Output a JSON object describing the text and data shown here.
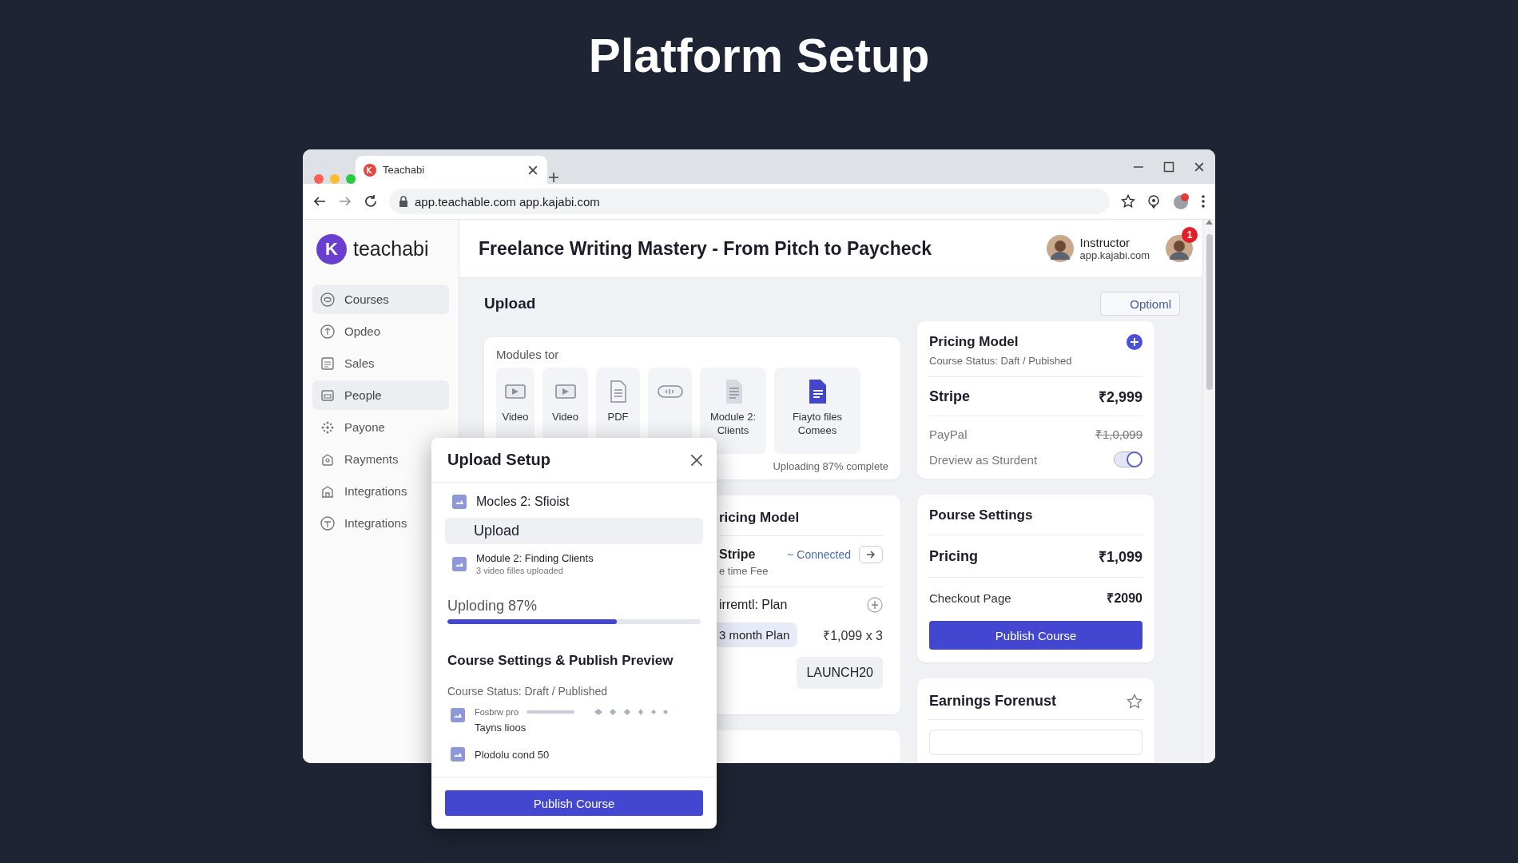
{
  "page_title": "Platform Setup",
  "browser": {
    "tab_title": "Teachabi",
    "url": "app.teachable.com app.kajabi.com"
  },
  "sidebar": {
    "brand_letter": "K",
    "brand": "teachabi",
    "items": [
      {
        "label": "Courses",
        "selected": true
      },
      {
        "label": "Opdeo",
        "selected": false
      },
      {
        "label": "Sales",
        "selected": false
      },
      {
        "label": "People",
        "selected": true
      },
      {
        "label": "Payone",
        "selected": false
      },
      {
        "label": "Rayments",
        "selected": false
      },
      {
        "label": "Integrations",
        "selected": false
      },
      {
        "label": "Integrations",
        "selected": false
      }
    ]
  },
  "header": {
    "title": "Freelance Writing Mastery - From Pitch to Paycheck",
    "user_role": "Instructor",
    "user_domain": "app.kajabi.com",
    "notification_badge": "1"
  },
  "upload": {
    "heading": "Upload",
    "option_button": "Optioml"
  },
  "modules_card": {
    "title": "Modules tor",
    "tiles": [
      {
        "kind": "video",
        "label": "Video"
      },
      {
        "kind": "video",
        "label": "Video"
      },
      {
        "kind": "pdf",
        "label": "PDF"
      },
      {
        "kind": "link"
      },
      {
        "kind": "doc",
        "label": "Module 2: Clients"
      },
      {
        "kind": "file",
        "label": "Fiayto files Comees"
      }
    ],
    "status": "Uploading 87% complete"
  },
  "pricing_middle": {
    "title": "ricing Model",
    "provider": "Stripe",
    "connection": "~ Connected",
    "fee": "e time Fee",
    "plan_heading": "irremtl: Plan",
    "plan": "3 month Plan",
    "plan_price": "₹1,099 x 3",
    "coupon": "LAUNCH20"
  },
  "pricing_model": {
    "title": "Pricing Model",
    "status": "Course Status: Daft / Pubished",
    "rows": [
      {
        "kind": "primary",
        "label": "Stripe",
        "value": "₹2,999"
      },
      {
        "kind": "struck",
        "label": "PayPal",
        "value": "₹1,0,099"
      }
    ],
    "preview_toggle": {
      "label": "Dreview as Sturdent",
      "on": true
    }
  },
  "course_settings": {
    "title": "Pourse Settings",
    "rows": [
      {
        "kind": "primary",
        "label": "Pricing",
        "value": "₹1,099"
      },
      {
        "kind": "plain",
        "label": "Checkout Page",
        "value": "₹2090"
      }
    ],
    "button": "Publish Course"
  },
  "earnings": {
    "title": "Earnings Forenust"
  },
  "modal": {
    "title": "Upload Setup",
    "items": [
      {
        "kind": "module",
        "title": "Mocles 2: Sfioist"
      },
      {
        "kind": "upload",
        "title": "Upload"
      },
      {
        "kind": "module",
        "title": "Module 2: Finding Clients",
        "subtitle": "3 video filles uploaded"
      }
    ],
    "progress": {
      "label": "Uploding 87%",
      "level": 0.67
    },
    "section_title": "Course Settings & Publish Preview",
    "status": "Course Status: Draft / Published",
    "preview_items": [
      {
        "kind": "scale",
        "label": "Fosbrw pro",
        "note": "Tayns lioos"
      },
      {
        "kind": "plain",
        "label": "Plodolu cond 50"
      }
    ],
    "button": "Publish Course"
  }
}
